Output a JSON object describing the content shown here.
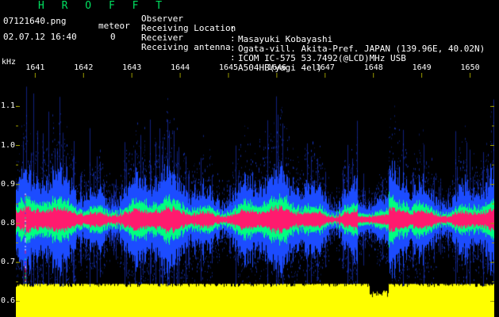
{
  "header": {
    "title": "H R O F F T",
    "file_name": "07121640.png",
    "meteor_label": "meteor",
    "datetime": "02.07.12 16:40",
    "meteor_count": "0"
  },
  "info": [
    {
      "key": "Observer",
      "value": "Masayuki Kobayashi"
    },
    {
      "key": "Receiving Location",
      "value": "Ogata-vill. Akita-Pref. JAPAN (139.96E, 40.02N)"
    },
    {
      "key": "Receiver",
      "value": "ICOM IC-575 53.7492(@LCD)MHz USB"
    },
    {
      "key": "Receiving antenna",
      "value": "A504HB(yagi 4el)"
    }
  ],
  "axes": {
    "unit": "kHz",
    "y_ticks": [
      "1.1",
      "1.0",
      "0.9",
      "0.8",
      "0.7",
      "0.6"
    ],
    "y_range": [
      0.56,
      1.18
    ],
    "x_ticks": [
      "1641",
      "1642",
      "1643",
      "1644",
      "1645",
      "1646",
      "1647",
      "1648",
      "1649",
      "1650"
    ],
    "x_range_minutes": [
      1640.6,
      1650.5
    ]
  },
  "spectrogram": {
    "signal_center_khz": 0.81,
    "noise_floor_top_khz": 0.645,
    "colors": {
      "background": "#000000",
      "noise": "#ffff00",
      "signal_core": "#ff1a6e",
      "signal_mid": "#00ff80",
      "signal_outer": "#1c4cff",
      "axis": "#9a9a00",
      "title": "#00e060"
    }
  }
}
